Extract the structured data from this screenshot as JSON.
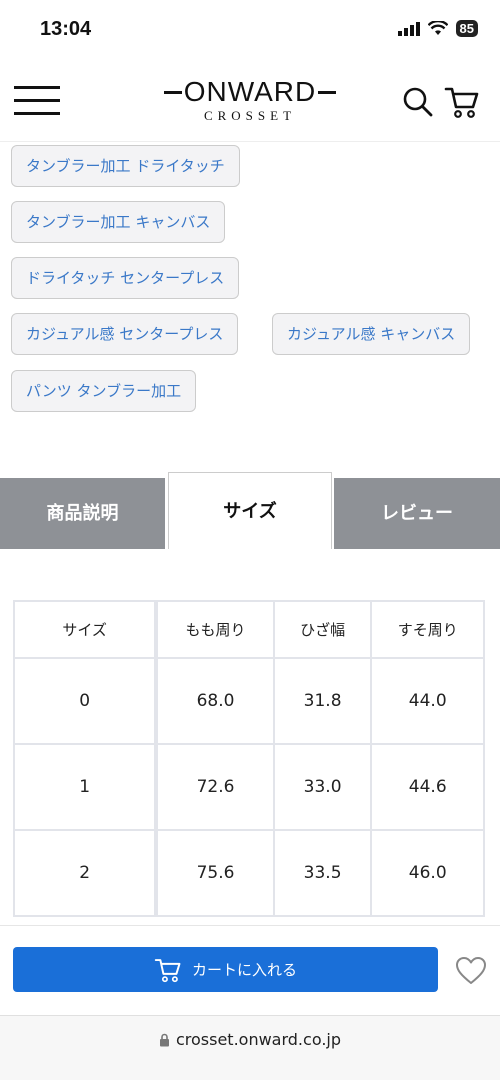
{
  "status_bar": {
    "time": "13:04",
    "battery": "85"
  },
  "header": {
    "logo_main": "ONWARD",
    "logo_sub": "CROSSET"
  },
  "tags": [
    "タンブラー加工 ドライタッチ",
    "タンブラー加工 キャンバス",
    "ドライタッチ センタープレス",
    "カジュアル感 センタープレス",
    "カジュアル感 キャンバス",
    "パンツ タンブラー加工"
  ],
  "tabs": {
    "description": "商品説明",
    "size": "サイズ",
    "review": "レビュー"
  },
  "size_table": {
    "headers": [
      "サイズ",
      "もも周り",
      "ひざ幅",
      "すそ周り"
    ],
    "rows": [
      [
        "0",
        "68.0",
        "31.8",
        "44.0"
      ],
      [
        "1",
        "72.6",
        "33.0",
        "44.6"
      ],
      [
        "2",
        "75.6",
        "33.5",
        "46.0"
      ]
    ]
  },
  "cart": {
    "label": "カートに入れる"
  },
  "url_bar": {
    "url": "crosset.onward.co.jp"
  },
  "colors": {
    "accent": "#1a6fd8",
    "tag_text": "#3a78c8",
    "tab_inactive": "#8e9196"
  }
}
